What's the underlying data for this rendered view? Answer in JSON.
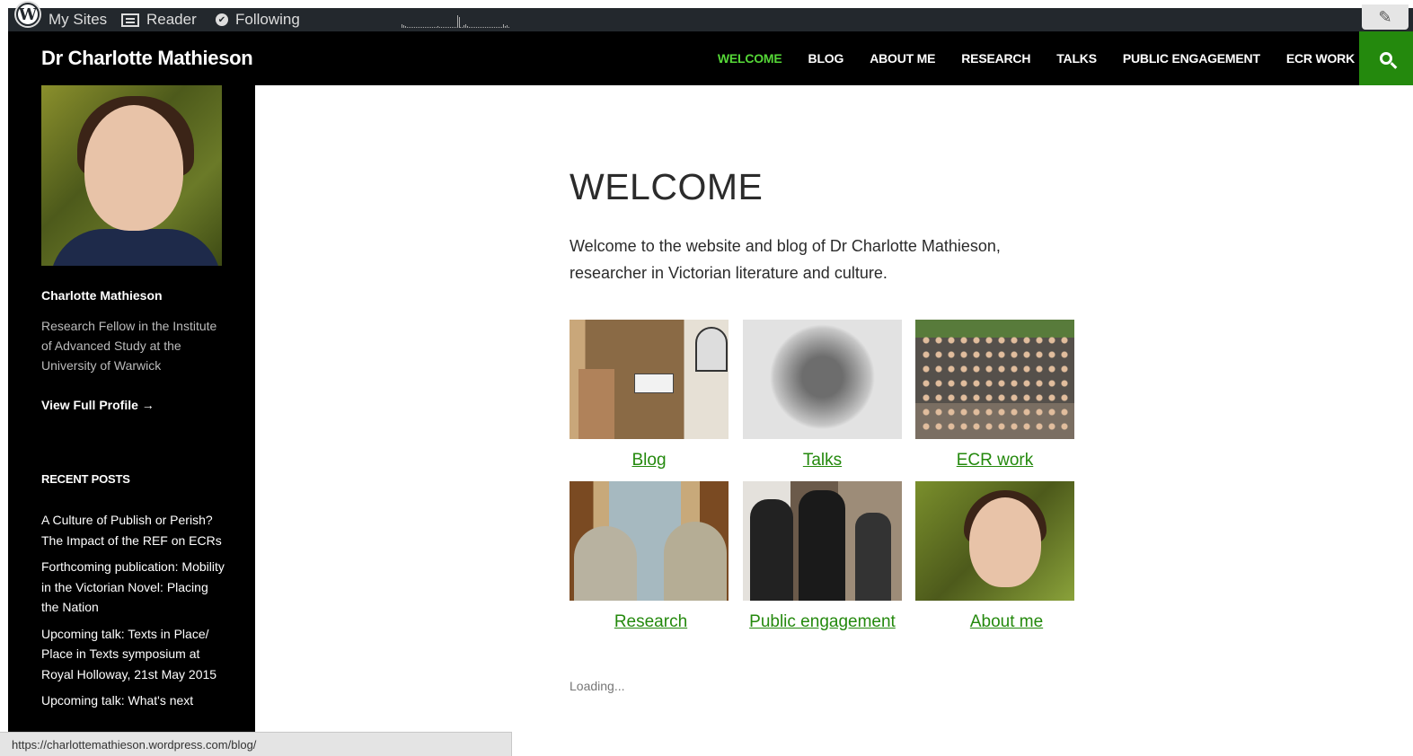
{
  "adminbar": {
    "my_sites": "My Sites",
    "reader": "Reader",
    "following": "Following"
  },
  "header": {
    "site_title": "Dr Charlotte Mathieson",
    "nav": [
      "WELCOME",
      "BLOG",
      "ABOUT ME",
      "RESEARCH",
      "TALKS",
      "PUBLIC ENGAGEMENT",
      "ECR WORK"
    ],
    "active_nav": "WELCOME",
    "accent_color": "#24890d",
    "active_color": "#55d737"
  },
  "sidebar": {
    "profile_name": "Charlotte Mathieson",
    "profile_bio": "Research Fellow in the Institute of Advanced Study at the University of Warwick",
    "profile_link": "View Full Profile →",
    "recent_title": "RECENT POSTS",
    "recent_posts": [
      "A Culture of Publish or Perish? The Impact of the REF on ECRs",
      "Forthcoming publication: Mobility in the Victorian Novel: Placing the Nation",
      "Upcoming talk: Texts in Place/ Place in Texts symposium at Royal Holloway, 21st May 2015",
      "Upcoming talk: What's next"
    ]
  },
  "main": {
    "title": "WELCOME",
    "intro": "Welcome to the website and blog of Dr Charlotte Mathieson, researcher in Victorian literature and culture.",
    "tiles": [
      {
        "label": "Blog"
      },
      {
        "label": "Talks"
      },
      {
        "label": "ECR work"
      },
      {
        "label": "Research"
      },
      {
        "label": "Public engagement"
      },
      {
        "label": "About me"
      }
    ],
    "loading": "Loading..."
  },
  "statusbar": {
    "url": "https://charlottemathieson.wordpress.com/blog/"
  }
}
